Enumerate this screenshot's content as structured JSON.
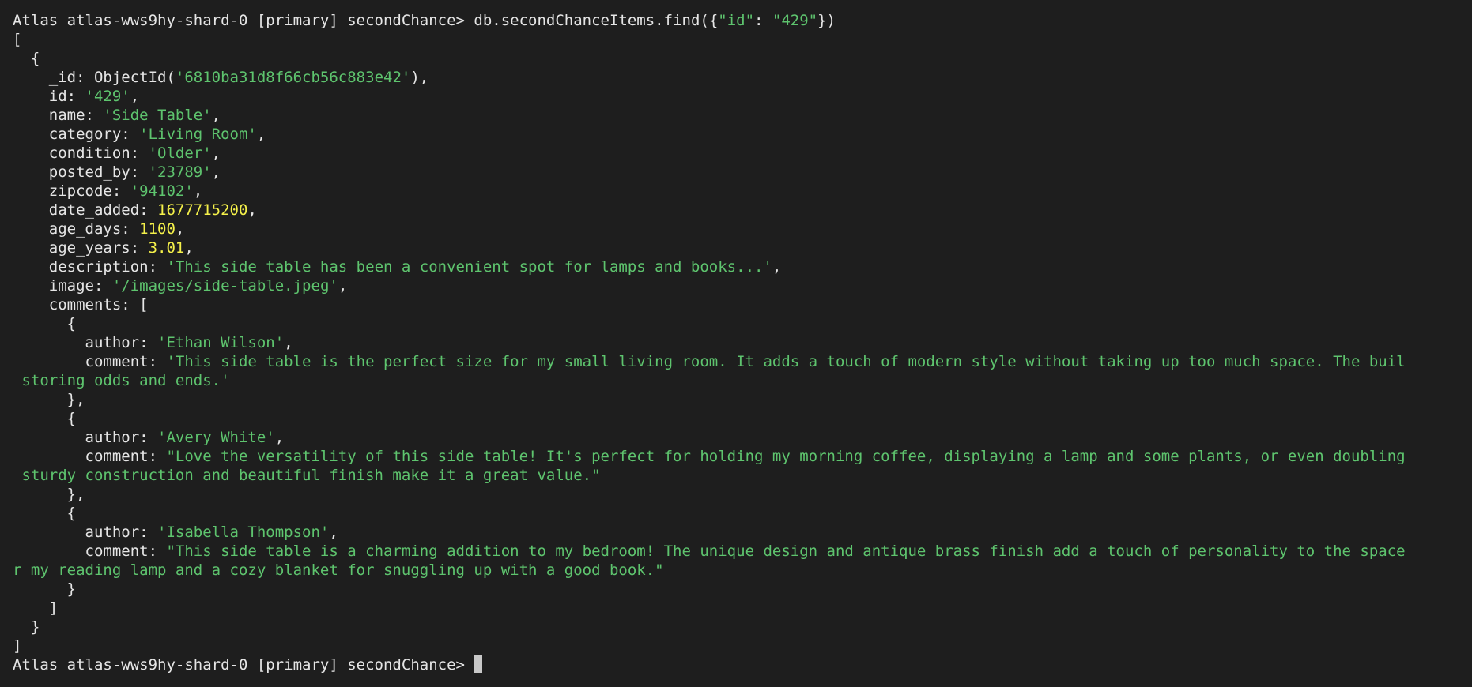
{
  "prompt": "Atlas atlas-wws9hy-shard-0 [primary] secondChance>",
  "command": {
    "call": "db.secondChanceItems.find({",
    "key": "\"id\"",
    "colon": ": ",
    "value": "\"429\"",
    "close": "})"
  },
  "output": {
    "open_bracket": "[",
    "open_brace": "  {",
    "fields": {
      "_id": {
        "label": "    _id: ",
        "pre": "ObjectId(",
        "value": "'6810ba31d8f66cb56c883e42'",
        "post": "),"
      },
      "id": {
        "label": "    id: ",
        "value": "'429'",
        "post": ","
      },
      "name": {
        "label": "    name: ",
        "value": "'Side Table'",
        "post": ","
      },
      "category": {
        "label": "    category: ",
        "value": "'Living Room'",
        "post": ","
      },
      "condition": {
        "label": "    condition: ",
        "value": "'Older'",
        "post": ","
      },
      "posted_by": {
        "label": "    posted_by: ",
        "value": "'23789'",
        "post": ","
      },
      "zipcode": {
        "label": "    zipcode: ",
        "value": "'94102'",
        "post": ","
      },
      "date_added": {
        "label": "    date_added: ",
        "value": "1677715200",
        "post": ","
      },
      "age_days": {
        "label": "    age_days: ",
        "value": "1100",
        "post": ","
      },
      "age_years": {
        "label": "    age_years: ",
        "value": "3.01",
        "post": ","
      },
      "description": {
        "label": "    description: ",
        "value": "'This side table has been a convenient spot for lamps and books...'",
        "post": ","
      },
      "image": {
        "label": "    image: ",
        "value": "'/images/side-table.jpeg'",
        "post": ","
      },
      "comments": {
        "label": "    comments: ["
      }
    },
    "comments": [
      {
        "open": "      {",
        "author_label": "        author: ",
        "author": "'Ethan Wilson'",
        "author_post": ",",
        "comment_label": "        comment: ",
        "comment_line1": "'This side table is the perfect size for my small living room. It adds a touch of modern style without taking up too much space. The buil",
        "comment_line2": " storing odds and ends.'",
        "close": "      },"
      },
      {
        "open": "      {",
        "author_label": "        author: ",
        "author": "'Avery White'",
        "author_post": ",",
        "comment_label": "        comment: ",
        "comment_line1": "\"Love the versatility of this side table! It's perfect for holding my morning coffee, displaying a lamp and some plants, or even doubling",
        "comment_line2": " sturdy construction and beautiful finish make it a great value.\"",
        "close": "      },"
      },
      {
        "open": "      {",
        "author_label": "        author: ",
        "author": "'Isabella Thompson'",
        "author_post": ",",
        "comment_label": "        comment: ",
        "comment_line1": "\"This side table is a charming addition to my bedroom! The unique design and antique brass finish add a touch of personality to the space",
        "comment_line2": "r my reading lamp and a cozy blanket for snuggling up with a good book.\"",
        "close": "      }"
      }
    ],
    "comments_close": "    ]",
    "close_brace": "  }",
    "close_bracket": "]"
  },
  "colors": {
    "background": "#1e1e1e",
    "text": "#e6e6e6",
    "string": "#5ec46e",
    "number": "#f5f14a"
  }
}
